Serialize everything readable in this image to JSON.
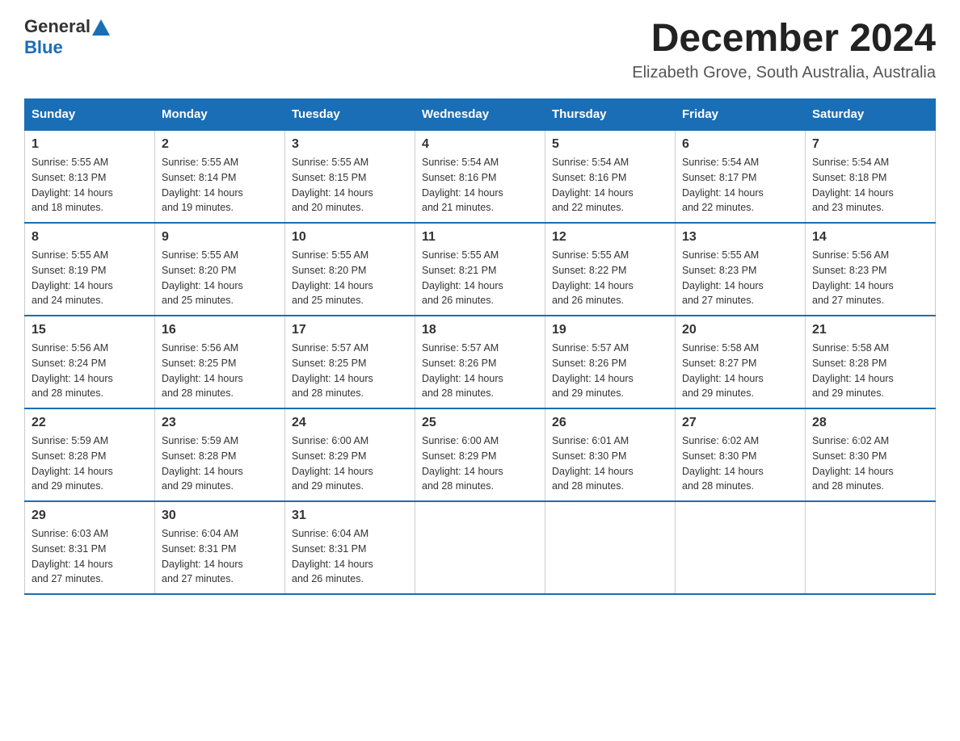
{
  "header": {
    "logo_general": "General",
    "logo_blue": "Blue",
    "month_title": "December 2024",
    "location": "Elizabeth Grove, South Australia, Australia"
  },
  "days_of_week": [
    "Sunday",
    "Monday",
    "Tuesday",
    "Wednesday",
    "Thursday",
    "Friday",
    "Saturday"
  ],
  "weeks": [
    [
      {
        "day": "1",
        "sunrise": "5:55 AM",
        "sunset": "8:13 PM",
        "daylight": "14 hours and 18 minutes."
      },
      {
        "day": "2",
        "sunrise": "5:55 AM",
        "sunset": "8:14 PM",
        "daylight": "14 hours and 19 minutes."
      },
      {
        "day": "3",
        "sunrise": "5:55 AM",
        "sunset": "8:15 PM",
        "daylight": "14 hours and 20 minutes."
      },
      {
        "day": "4",
        "sunrise": "5:54 AM",
        "sunset": "8:16 PM",
        "daylight": "14 hours and 21 minutes."
      },
      {
        "day": "5",
        "sunrise": "5:54 AM",
        "sunset": "8:16 PM",
        "daylight": "14 hours and 22 minutes."
      },
      {
        "day": "6",
        "sunrise": "5:54 AM",
        "sunset": "8:17 PM",
        "daylight": "14 hours and 22 minutes."
      },
      {
        "day": "7",
        "sunrise": "5:54 AM",
        "sunset": "8:18 PM",
        "daylight": "14 hours and 23 minutes."
      }
    ],
    [
      {
        "day": "8",
        "sunrise": "5:55 AM",
        "sunset": "8:19 PM",
        "daylight": "14 hours and 24 minutes."
      },
      {
        "day": "9",
        "sunrise": "5:55 AM",
        "sunset": "8:20 PM",
        "daylight": "14 hours and 25 minutes."
      },
      {
        "day": "10",
        "sunrise": "5:55 AM",
        "sunset": "8:20 PM",
        "daylight": "14 hours and 25 minutes."
      },
      {
        "day": "11",
        "sunrise": "5:55 AM",
        "sunset": "8:21 PM",
        "daylight": "14 hours and 26 minutes."
      },
      {
        "day": "12",
        "sunrise": "5:55 AM",
        "sunset": "8:22 PM",
        "daylight": "14 hours and 26 minutes."
      },
      {
        "day": "13",
        "sunrise": "5:55 AM",
        "sunset": "8:23 PM",
        "daylight": "14 hours and 27 minutes."
      },
      {
        "day": "14",
        "sunrise": "5:56 AM",
        "sunset": "8:23 PM",
        "daylight": "14 hours and 27 minutes."
      }
    ],
    [
      {
        "day": "15",
        "sunrise": "5:56 AM",
        "sunset": "8:24 PM",
        "daylight": "14 hours and 28 minutes."
      },
      {
        "day": "16",
        "sunrise": "5:56 AM",
        "sunset": "8:25 PM",
        "daylight": "14 hours and 28 minutes."
      },
      {
        "day": "17",
        "sunrise": "5:57 AM",
        "sunset": "8:25 PM",
        "daylight": "14 hours and 28 minutes."
      },
      {
        "day": "18",
        "sunrise": "5:57 AM",
        "sunset": "8:26 PM",
        "daylight": "14 hours and 28 minutes."
      },
      {
        "day": "19",
        "sunrise": "5:57 AM",
        "sunset": "8:26 PM",
        "daylight": "14 hours and 29 minutes."
      },
      {
        "day": "20",
        "sunrise": "5:58 AM",
        "sunset": "8:27 PM",
        "daylight": "14 hours and 29 minutes."
      },
      {
        "day": "21",
        "sunrise": "5:58 AM",
        "sunset": "8:28 PM",
        "daylight": "14 hours and 29 minutes."
      }
    ],
    [
      {
        "day": "22",
        "sunrise": "5:59 AM",
        "sunset": "8:28 PM",
        "daylight": "14 hours and 29 minutes."
      },
      {
        "day": "23",
        "sunrise": "5:59 AM",
        "sunset": "8:28 PM",
        "daylight": "14 hours and 29 minutes."
      },
      {
        "day": "24",
        "sunrise": "6:00 AM",
        "sunset": "8:29 PM",
        "daylight": "14 hours and 29 minutes."
      },
      {
        "day": "25",
        "sunrise": "6:00 AM",
        "sunset": "8:29 PM",
        "daylight": "14 hours and 28 minutes."
      },
      {
        "day": "26",
        "sunrise": "6:01 AM",
        "sunset": "8:30 PM",
        "daylight": "14 hours and 28 minutes."
      },
      {
        "day": "27",
        "sunrise": "6:02 AM",
        "sunset": "8:30 PM",
        "daylight": "14 hours and 28 minutes."
      },
      {
        "day": "28",
        "sunrise": "6:02 AM",
        "sunset": "8:30 PM",
        "daylight": "14 hours and 28 minutes."
      }
    ],
    [
      {
        "day": "29",
        "sunrise": "6:03 AM",
        "sunset": "8:31 PM",
        "daylight": "14 hours and 27 minutes."
      },
      {
        "day": "30",
        "sunrise": "6:04 AM",
        "sunset": "8:31 PM",
        "daylight": "14 hours and 27 minutes."
      },
      {
        "day": "31",
        "sunrise": "6:04 AM",
        "sunset": "8:31 PM",
        "daylight": "14 hours and 26 minutes."
      },
      null,
      null,
      null,
      null
    ]
  ],
  "labels": {
    "sunrise": "Sunrise:",
    "sunset": "Sunset:",
    "daylight": "Daylight:"
  }
}
